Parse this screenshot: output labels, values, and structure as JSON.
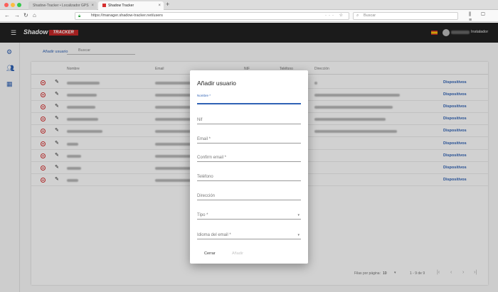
{
  "browser": {
    "tabs": [
      {
        "label": "Shadow-Tracker • Localizador GPS",
        "active": false
      },
      {
        "label": "Shadow Tracker",
        "active": true
      }
    ],
    "url": "https://manager.shadow-tracker.net/users",
    "search_placeholder": "Buscar"
  },
  "app": {
    "logo_main": "Shadow",
    "logo_sub": "TRACKER",
    "user_role": "Instalador"
  },
  "toolbar": {
    "add_user": "Añadir usuario",
    "search_placeholder": "Buscar"
  },
  "table": {
    "columns": {
      "name": "Nombre",
      "email": "Email",
      "nif": "NIF",
      "phone": "Teléfono",
      "address": "Dirección"
    },
    "devices_label": "Dispositivos",
    "row_count": 9
  },
  "pager": {
    "label": "Filas por página:",
    "page_size": "10",
    "range": "1 - 9 de 9"
  },
  "dialog": {
    "title": "Añadir usuario",
    "fields": {
      "name": "Nombre *",
      "nif": "Nif",
      "email": "Email *",
      "confirm_email": "Confirm email *",
      "phone": "Teléfono",
      "address": "Dirección",
      "type": "Tipo *",
      "email_lang": "Idioma del email *"
    },
    "close_label": "Cerrar",
    "add_label": "Añadir"
  },
  "colors": {
    "accent": "#2f62b5",
    "danger": "#d32f2f",
    "header": "#212121",
    "brand_red": "#c62828"
  }
}
